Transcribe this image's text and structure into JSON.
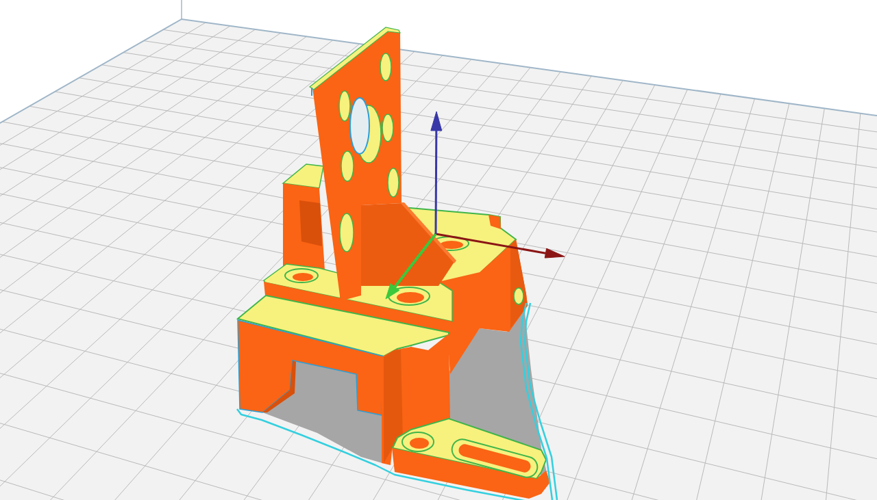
{
  "viewport": {
    "axes": [
      {
        "kind": "x",
        "color": "#8b1515"
      },
      {
        "kind": "y",
        "color": "#3cc83c"
      },
      {
        "kind": "z",
        "color": "#3838a8"
      }
    ]
  }
}
